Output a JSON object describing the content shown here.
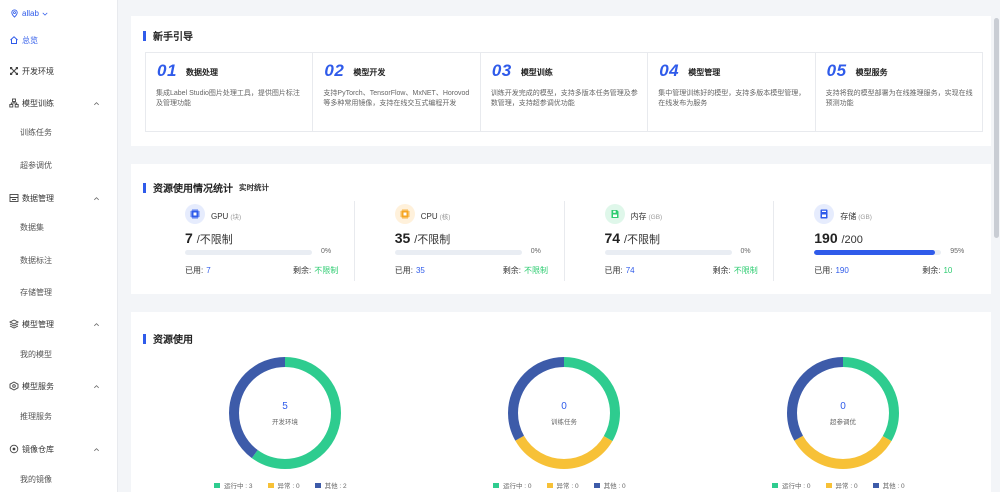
{
  "workspace": {
    "name": "allab"
  },
  "sidebar": {
    "items": [
      {
        "label": "总览",
        "icon": "home-icon",
        "active": true
      },
      {
        "label": "开发环境",
        "icon": "dev-env-icon"
      },
      {
        "label": "模型训练",
        "icon": "train-icon",
        "expanded": true,
        "children": [
          "训练任务",
          "超参调优"
        ]
      },
      {
        "label": "数据管理",
        "icon": "data-icon",
        "expanded": true,
        "children": [
          "数据集",
          "数据标注",
          "存储管理"
        ]
      },
      {
        "label": "模型管理",
        "icon": "model-icon",
        "expanded": true,
        "children": [
          "我的模型"
        ]
      },
      {
        "label": "模型服务",
        "icon": "service-icon",
        "expanded": true,
        "children": [
          "推理服务"
        ]
      },
      {
        "label": "镜像仓库",
        "icon": "image-repo-icon",
        "expanded": true,
        "children": [
          "我的镜像"
        ]
      }
    ]
  },
  "guide": {
    "title": "新手引导",
    "cards": [
      {
        "num": "01",
        "name": "数据处理",
        "desc": "集成Label Studio图片处理工具，提供图片标注及管理功能"
      },
      {
        "num": "02",
        "name": "模型开发",
        "desc": "支持PyTorch、TensorFlow、MxNET、Horovod等多种常用镜像，支持在线交互式编程开发"
      },
      {
        "num": "03",
        "name": "模型训练",
        "desc": "训练开发完成的模型，支持多版本任务管理及参数管理，支持超参调优功能"
      },
      {
        "num": "04",
        "name": "模型管理",
        "desc": "集中管理训练好的模型，支持多版本模型管理，在线发布为服务"
      },
      {
        "num": "05",
        "name": "模型服务",
        "desc": "支持将我的模型部署为在线推理服务，实现在线预测功能"
      }
    ]
  },
  "resources": {
    "title": "资源使用情况统计",
    "subtitle": "实时统计",
    "used_label": "已用:",
    "left_label": "剩余:",
    "items": [
      {
        "name": "GPU",
        "unit": "(块)",
        "value": "7",
        "limit": "/不限制",
        "percent_text": "0%",
        "fraction": 0,
        "used": "7",
        "left": "不限制",
        "icon": "gpu-icon",
        "color": "#2f5bea"
      },
      {
        "name": "CPU",
        "unit": "(核)",
        "value": "35",
        "limit": "/不限制",
        "percent_text": "0%",
        "fraction": 0,
        "used": "35",
        "left": "不限制",
        "icon": "cpu-icon",
        "color": "#f5a623"
      },
      {
        "name": "内存",
        "unit": "(GB)",
        "value": "74",
        "limit": "/不限制",
        "percent_text": "0%",
        "fraction": 0,
        "used": "74",
        "left": "不限制",
        "icon": "memory-icon",
        "color": "#2ecc71"
      },
      {
        "name": "存储",
        "unit": "(GB)",
        "value": "190",
        "limit": "/200",
        "percent_text": "95%",
        "fraction": 0.95,
        "used": "190",
        "left": "10",
        "icon": "storage-icon",
        "color": "#2f5bea"
      }
    ]
  },
  "usage": {
    "title": "资源使用",
    "colors": {
      "running": "#2ecc8f",
      "error": "#f7c137",
      "other": "#3d5ba9"
    },
    "donuts": [
      {
        "value": "5",
        "label": "开发环境",
        "running": 3,
        "error": 0,
        "other": 2,
        "legend": [
          "运行中 : 3",
          "异常 : 0",
          "其他 : 2"
        ]
      },
      {
        "value": "0",
        "label": "训练任务",
        "running": 0,
        "error": 0,
        "other": 0,
        "legend": [
          "运行中 : 0",
          "异常 : 0",
          "其他 : 0"
        ]
      },
      {
        "value": "0",
        "label": "超参调优",
        "running": 0,
        "error": 0,
        "other": 0,
        "legend": [
          "运行中 : 0",
          "异常 : 0",
          "其他 : 0"
        ]
      }
    ]
  }
}
